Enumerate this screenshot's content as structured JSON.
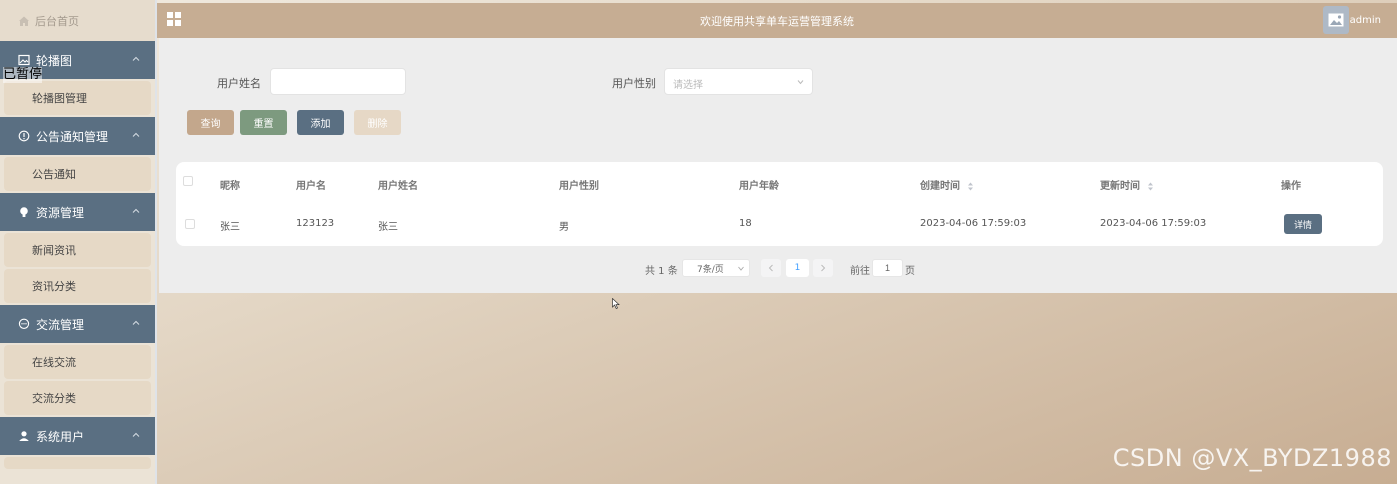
{
  "sidebar": {
    "home": "后台首页",
    "groups": [
      {
        "label": "轮播图",
        "icon": "image-icon",
        "items": [
          "轮播图管理"
        ]
      },
      {
        "label": "公告通知管理",
        "icon": "info-circle-icon",
        "items": [
          "公告通知"
        ]
      },
      {
        "label": "资源管理",
        "icon": "bulb-icon",
        "items": [
          "新闻资讯",
          "资讯分类"
        ]
      },
      {
        "label": "交流管理",
        "icon": "chat-icon",
        "items": [
          "在线交流",
          "交流分类"
        ]
      },
      {
        "label": "系统用户",
        "icon": "user-icon",
        "items": []
      }
    ]
  },
  "overlay": {
    "paused": "已暂停"
  },
  "topbar": {
    "title": "欢迎使用共享单车运营管理系统",
    "username": "admin"
  },
  "filters": {
    "name_label": "用户姓名",
    "name_value": "",
    "gender_label": "用户性别",
    "gender_placeholder": "请选择"
  },
  "buttons": {
    "query": "查询",
    "reset": "重置",
    "add": "添加",
    "delete": "删除"
  },
  "colors": {
    "query": "#c3a78c",
    "reset": "#7d9a7f",
    "add": "#5a6f82",
    "delete": "#e6d8c6",
    "menu_group": "#5a6f82",
    "topbar": "#c6ad93"
  },
  "table": {
    "headers": [
      "昵称",
      "用户名",
      "用户姓名",
      "用户性别",
      "用户年龄",
      "创建时间",
      "更新时间",
      "操作"
    ],
    "rows": [
      {
        "nickname": "张三",
        "username": "123123",
        "realname": "张三",
        "gender": "男",
        "age": "18",
        "created": "2023-04-06 17:59:03",
        "updated": "2023-04-06 17:59:03",
        "action": "详情"
      }
    ]
  },
  "pagination": {
    "total": "共 1 条",
    "page_size": "7条/页",
    "current_page": "1",
    "goto_label": "前往",
    "goto_value": "1",
    "page_suffix": "页"
  },
  "watermark": "CSDN @VX_BYDZ1988"
}
